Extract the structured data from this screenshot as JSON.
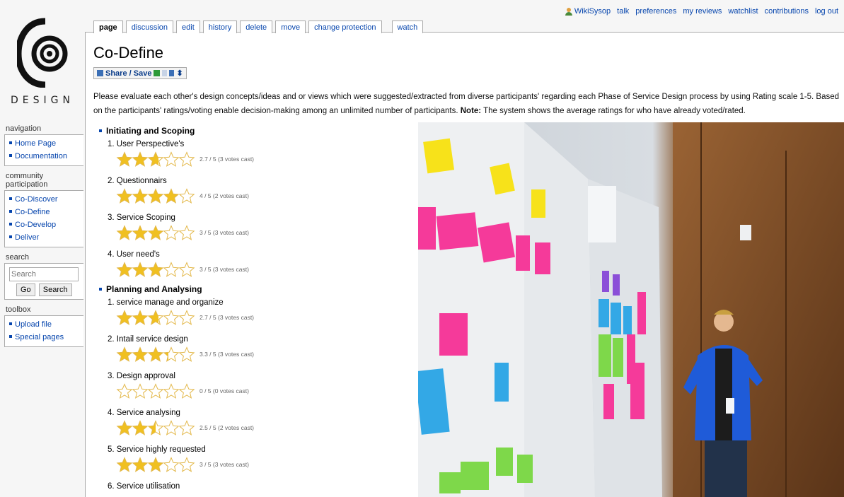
{
  "personal": {
    "user": "WikiSysop",
    "links": [
      "talk",
      "preferences",
      "my reviews",
      "watchlist",
      "contributions",
      "log out"
    ]
  },
  "logo": {
    "wordmark": "DESIGN"
  },
  "tabs": [
    "page",
    "discussion",
    "edit",
    "history",
    "delete",
    "move",
    "change protection",
    "watch"
  ],
  "sidebar": {
    "navigation": {
      "title": "navigation",
      "items": [
        "Home Page",
        "Documentation"
      ]
    },
    "community": {
      "title": "community participation",
      "items": [
        "Co-Discover",
        "Co-Define",
        "Co-Develop",
        "Deliver"
      ]
    },
    "search": {
      "title": "search",
      "placeholder": "Search",
      "go": "Go",
      "search": "Search"
    },
    "toolbox": {
      "title": "toolbox",
      "items": [
        "Upload file",
        "Special pages"
      ]
    }
  },
  "page": {
    "title": "Co-Define",
    "share_label": "Share / Save",
    "intro_text": "Please evaluate each other's design concepts/ideas and or views which were suggested/extracted from diverse participants' regarding each Phase of Service Design process by using Rating scale 1-5. Based on the participants' ratings/voting enable decision-making among an unlimited number of participants.",
    "note_label": "Note:",
    "note_text": "The system shows the average ratings for who have already voted/rated."
  },
  "phases": [
    {
      "title": "Initiating and Scoping",
      "items": [
        {
          "label": "1. User Perspective's",
          "rating": 2.7,
          "votes": "2.7 / 5 (3 votes cast)"
        },
        {
          "label": "2. Questionnairs",
          "rating": 4,
          "votes": "4 / 5 (2 votes cast)"
        },
        {
          "label": "3. Service Scoping",
          "rating": 3,
          "votes": "3 / 5 (3 votes cast)"
        },
        {
          "label": "4. User need's",
          "rating": 3,
          "votes": "3 / 5 (3 votes cast)"
        }
      ]
    },
    {
      "title": "Planning and Analysing",
      "items": [
        {
          "label": "1. service manage and organize",
          "rating": 2.7,
          "votes": "2.7 / 5 (3 votes cast)"
        },
        {
          "label": "2. Intail service design",
          "rating": 3.3,
          "votes": "3.3 / 5 (3 votes cast)"
        },
        {
          "label": "3. Design approval",
          "rating": 0,
          "votes": "0 / 5 (0 votes cast)"
        },
        {
          "label": "4. Service analysing",
          "rating": 2.5,
          "votes": "2.5 / 5 (2 votes cast)"
        },
        {
          "label": "5. Service highly requested",
          "rating": 3,
          "votes": "3 / 5 (3 votes cast)"
        },
        {
          "label": "6. Service utilisation",
          "rating": null,
          "votes": ""
        }
      ]
    }
  ],
  "colors": {
    "link": "#0645ad",
    "star_fill": "#f0c020",
    "star_empty": "#ffffff",
    "star_stroke": "#e3b84a"
  }
}
